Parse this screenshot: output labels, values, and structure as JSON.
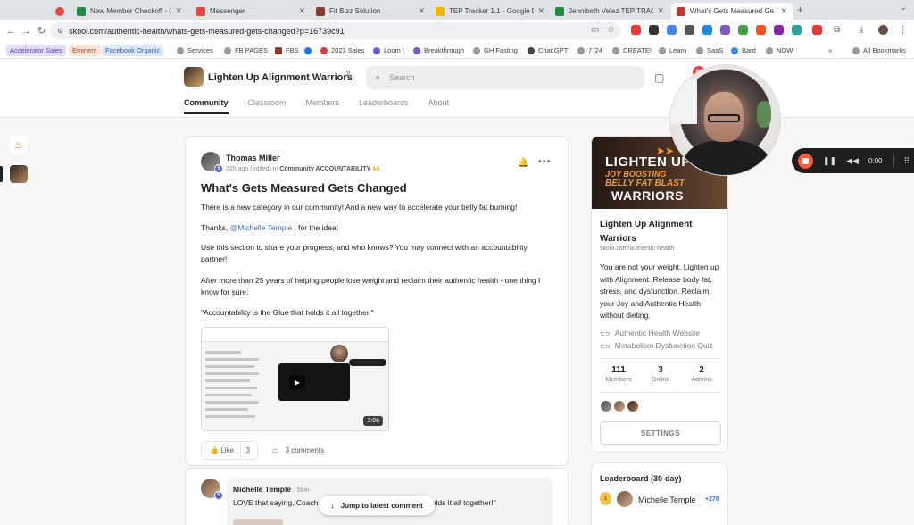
{
  "browser": {
    "tabs": [
      {
        "title": "New Member Checkoff - Goo",
        "color": "#1e8e3e"
      },
      {
        "title": "Messenger",
        "color": "#e8453c"
      },
      {
        "title": "Fit Bizz Solution",
        "color": "#8b3a2e"
      },
      {
        "title": "TEP Tracker 1.1 - Google Driv",
        "color": "#f4b400"
      },
      {
        "title": "Jennibeth Velez TEP TRACKE",
        "color": "#1e8e3e"
      },
      {
        "title": "What's Gets Measured Ge",
        "color": "#c0392b"
      }
    ],
    "url": "skool.com/authentic-health/whats-gets-measured-gets-changed?p=16739c91",
    "bookmarks": [
      {
        "label": "Accelerator Sales",
        "bg": "#e4dcfb",
        "fg": "#5b3fb8"
      },
      {
        "label": "Eminem",
        "bg": "#fbe3d6",
        "fg": "#9a4a20"
      },
      {
        "label": "Facebook Organic",
        "bg": "#dde8fb",
        "fg": "#2f5bb8"
      },
      {
        "label": "Services"
      },
      {
        "label": "FB PAGES"
      },
      {
        "label": "FBS"
      },
      {
        "label": "2023 Sales"
      },
      {
        "label": "Loom |"
      },
      {
        "label": "Breakthrough"
      },
      {
        "label": "GH Fasting"
      },
      {
        "label": "Chat GPT"
      },
      {
        "label": "7 '24"
      },
      {
        "label": "CREATE!"
      },
      {
        "label": "Learn"
      },
      {
        "label": "SaaS"
      },
      {
        "label": "Bard"
      },
      {
        "label": "NOW!"
      }
    ],
    "more_bookmarks": "»",
    "all_bookmarks": "All Bookmarks"
  },
  "header": {
    "group_name": "Lighten Up Alignment Warriors",
    "search_placeholder": "Search",
    "notification_count": "20",
    "nav": [
      "Community",
      "Classroom",
      "Members",
      "Leaderboards",
      "About"
    ]
  },
  "post": {
    "author": "Thomas Miller",
    "author_level": "5",
    "meta_prefix": "22h ago (edited) in",
    "category": "Community ACCOUNTABILITY",
    "category_emoji": "🙌",
    "title": "What's Gets Measured Gets Changed",
    "p1": "There is a new category in our community! And a new way to accelerate your belly fat burning!",
    "p2_prefix": "Thanks,",
    "p2_mention": "@Michelle Temple",
    "p2_suffix": ", for the idea!",
    "p3": "Use this section to share your progress, and who knows? You may connect with an accountability partner!",
    "p4": "After more than 25 years of helping people lose weight and reclaim their authentic health - one thing I know for sure:",
    "p5": "\"Accountability is the Glue that holds it all together.\"",
    "video_duration": "2:06",
    "like_label": "Like",
    "like_count": "3",
    "comments_label": "3 comments"
  },
  "comment": {
    "author": "Michelle Temple",
    "author_level": "5",
    "time": "59m",
    "text_start": "LOVE that saying, Coach",
    "text_end": "that holds it all together!\""
  },
  "jump_label": "Jump to latest comment",
  "sidebar": {
    "banner_line1": "LIGHTEN UP",
    "banner_line2": "JOY BOOSTING",
    "banner_line3": "BELLY FAT BLAST",
    "banner_line4": "WARRIORS",
    "group_name": "Lighten Up Alignment Warriors",
    "url": "skool.com/authentic-health",
    "description": "You are not your weight. Lighten up with Alignment. Release body fat, stress, and dysfunction. Reclaim your Joy and Authentic Health without dieting.",
    "links": [
      "Authentic Health Website",
      "Metabolism Dysfunction Quiz"
    ],
    "stats": [
      {
        "value": "111",
        "label": "Members"
      },
      {
        "value": "3",
        "label": "Online"
      },
      {
        "value": "2",
        "label": "Admins"
      }
    ],
    "settings_label": "SETTINGS"
  },
  "leaderboard": {
    "title": "Leaderboard (30-day)",
    "rank": "1",
    "name": "Michelle Temple",
    "points": "+278"
  },
  "recorder": {
    "time": "0:00"
  }
}
